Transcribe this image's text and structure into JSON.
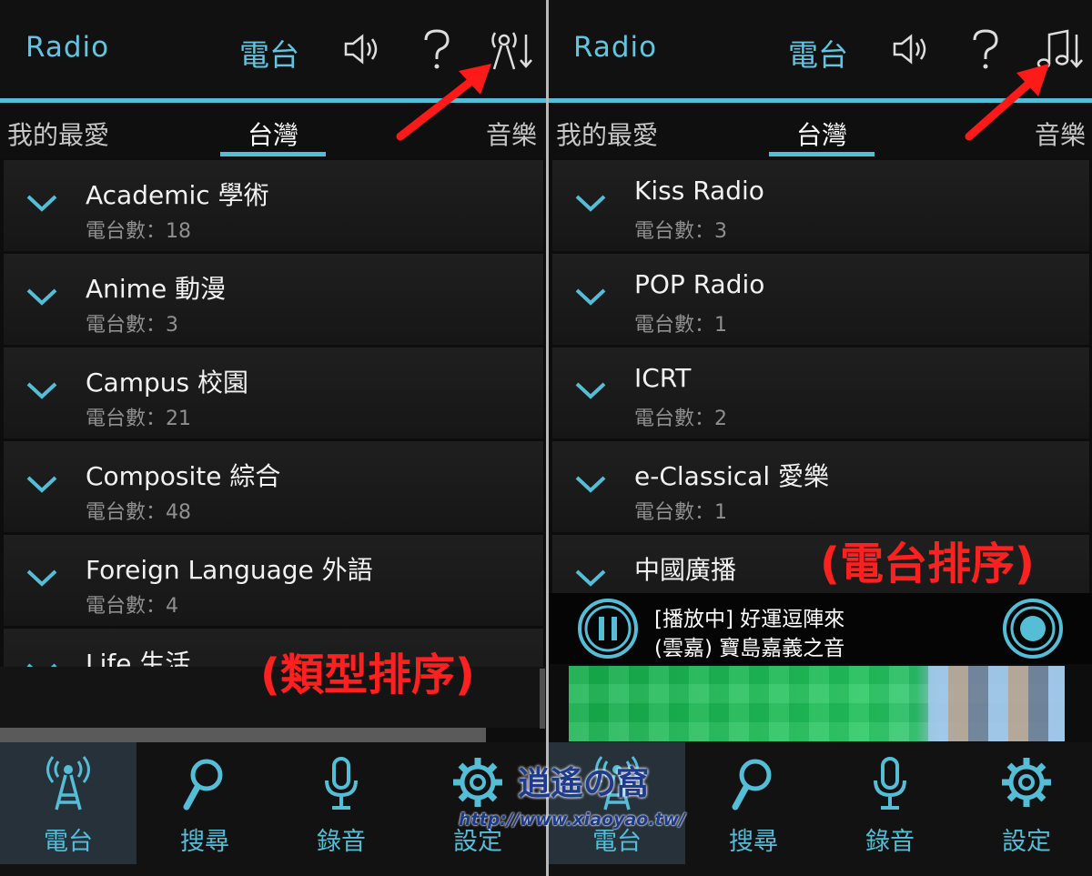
{
  "left": {
    "header": {
      "app_title": "Radio",
      "section_label": "電台"
    },
    "tabs": [
      {
        "label": "我的最愛"
      },
      {
        "label": "台灣"
      },
      {
        "label": "音樂"
      }
    ],
    "items": [
      {
        "name": "Academic 學術",
        "count": "電台數：18"
      },
      {
        "name": "Anime 動漫",
        "count": "電台數：3"
      },
      {
        "name": "Campus 校園",
        "count": "電台數：21"
      },
      {
        "name": "Composite 綜合",
        "count": "電台數：48"
      },
      {
        "name": "Foreign Language 外語",
        "count": "電台數：4"
      },
      {
        "name": "Life 生活"
      }
    ],
    "annotation": "(類型排序)",
    "sort_icon": "antenna-sort-icon"
  },
  "right": {
    "header": {
      "app_title": "Radio",
      "section_label": "電台"
    },
    "tabs": [
      {
        "label": "我的最愛"
      },
      {
        "label": "台灣"
      },
      {
        "label": "音樂"
      }
    ],
    "items": [
      {
        "name": "Kiss Radio",
        "count": "電台數：3"
      },
      {
        "name": "POP Radio",
        "count": "電台數：1"
      },
      {
        "name": "ICRT",
        "count": "電台數：2"
      },
      {
        "name": "e-Classical 愛樂",
        "count": "電台數：1"
      },
      {
        "name": "中國廣播"
      }
    ],
    "annotation": "(電台排序)",
    "sort_icon": "music-sort-icon",
    "player": {
      "line1": "[播放中] 好運逗陣來",
      "line2": "(雲嘉) 寶島嘉義之音"
    }
  },
  "nav": [
    {
      "label": "電台",
      "icon": "antenna-icon"
    },
    {
      "label": "搜尋",
      "icon": "search-icon"
    },
    {
      "label": "錄音",
      "icon": "microphone-icon"
    },
    {
      "label": "設定",
      "icon": "gear-icon"
    }
  ],
  "watermark": {
    "title": "逍遙の窩",
    "url": "http://www.xiaoyao.tw/"
  },
  "colors": {
    "accent": "#56bdd6",
    "annotation": "#ff2020",
    "background": "#0d0d0d"
  }
}
